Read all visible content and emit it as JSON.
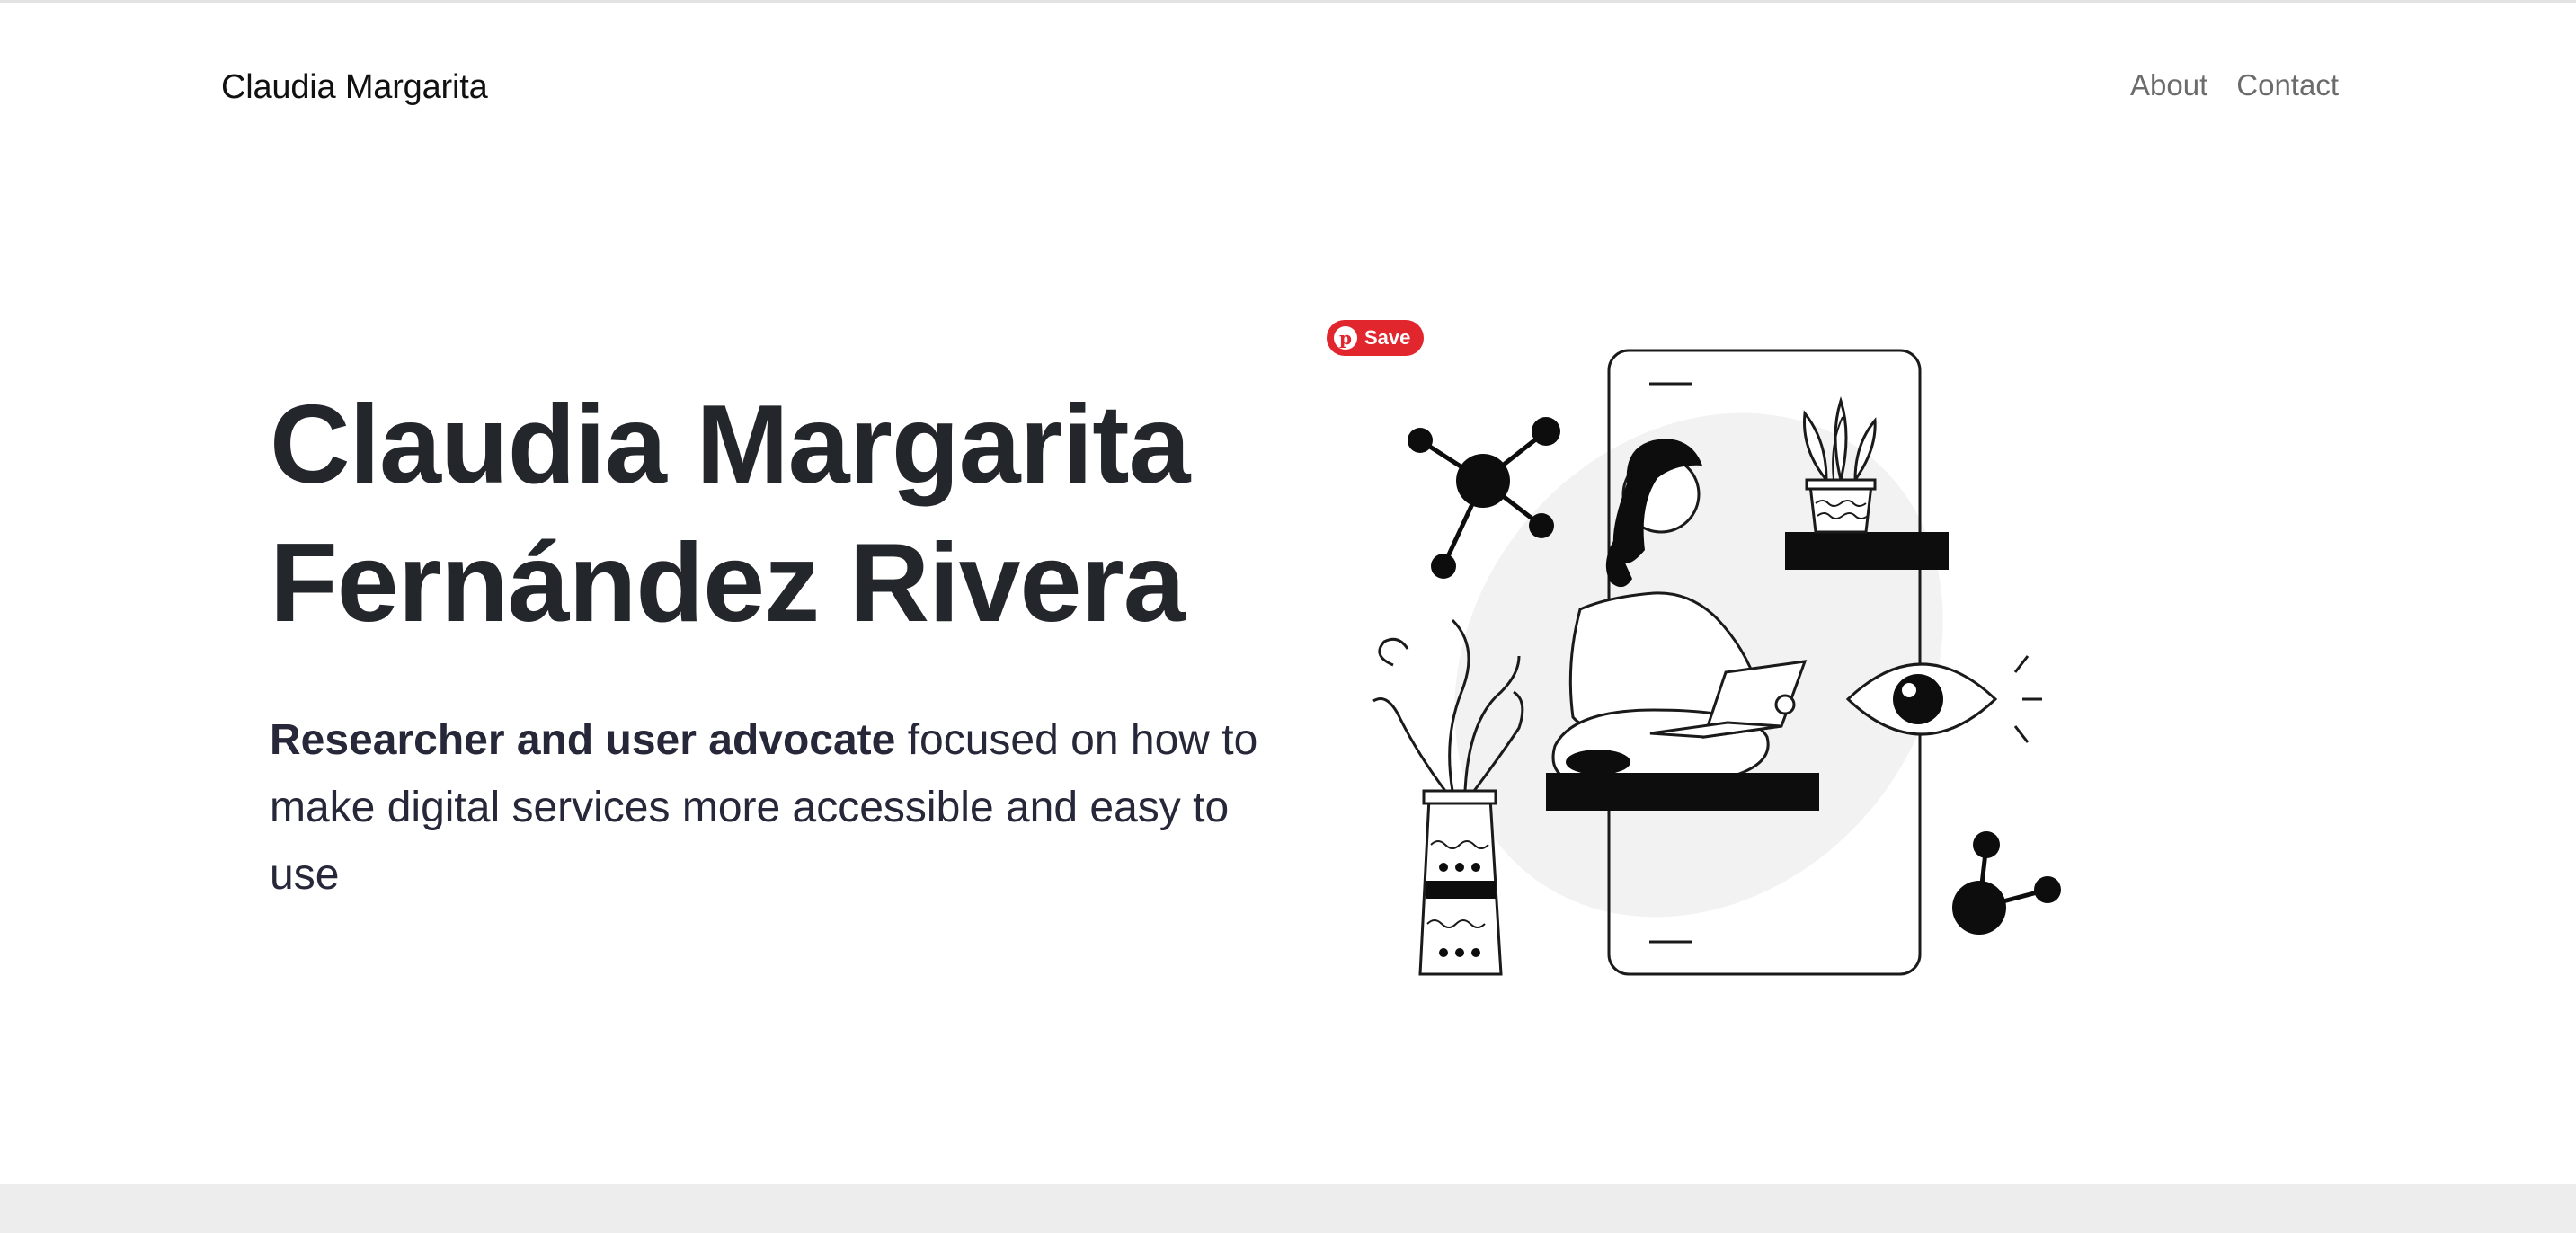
{
  "navbar": {
    "brand": "Claudia Margarita",
    "links": [
      {
        "label": "About"
      },
      {
        "label": "Contact"
      }
    ]
  },
  "hero": {
    "title_line1": "Claudia Margarita",
    "title_line2": "Fernández Rivera",
    "subtitle_bold": "Researcher and user advocate",
    "subtitle_rest": " focused on how to make digital services more accessible and easy to use"
  },
  "pinterest": {
    "save_label": "Save",
    "logo_glyph": "p"
  },
  "colors": {
    "title": "#23262b",
    "subtitle": "#262738",
    "nav_link": "#6b6b6b",
    "pinterest": "#e1262d",
    "blob": "#f2f2f2",
    "footer_band": "#ededed"
  },
  "illustration": {
    "icon": "woman-with-laptop-illustration"
  }
}
